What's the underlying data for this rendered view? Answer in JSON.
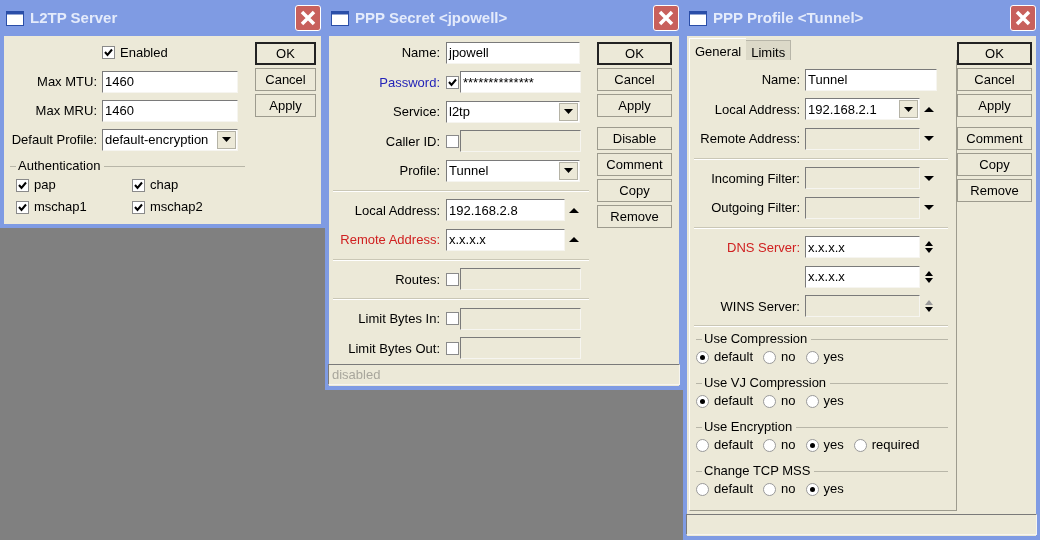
{
  "windows": [
    {
      "title": "L2TP Server",
      "rows": [
        {
          "kind": "check",
          "label": "Enabled",
          "checked": true
        },
        {
          "kind": "field",
          "label": "Max MTU:",
          "value": "1460"
        },
        {
          "kind": "field",
          "label": "Max MRU:",
          "value": "1460"
        },
        {
          "kind": "field",
          "label": "Default Profile:",
          "value": "default-encryption",
          "dropdown": true
        },
        {
          "kind": "check_group",
          "title": "Authentication",
          "items": [
            {
              "label": "pap",
              "checked": true
            },
            {
              "label": "chap",
              "checked": true
            },
            {
              "label": "mschap1",
              "checked": true
            },
            {
              "label": "mschap2",
              "checked": true
            }
          ]
        }
      ],
      "button_groups": [
        [
          "OK",
          "Cancel",
          "Apply"
        ]
      ]
    },
    {
      "title": "PPP Secret <jpowell>",
      "rows": [
        {
          "kind": "field",
          "label": "Name:",
          "value": "jpowell"
        },
        {
          "kind": "checkfield",
          "label": "Password:",
          "color": "#2323b8",
          "checked": true,
          "value": "**************"
        },
        {
          "kind": "field",
          "label": "Service:",
          "value": "l2tp",
          "dropdown": true
        },
        {
          "kind": "checkfield",
          "label": "Caller ID:",
          "checked": false,
          "disabled": true
        },
        {
          "kind": "field",
          "label": "Profile:",
          "value": "Tunnel",
          "dropdown": true
        },
        {
          "kind": "separator"
        },
        {
          "kind": "field",
          "label": "Local Address:",
          "value": "192.168.2.8",
          "arrow_up": true
        },
        {
          "kind": "field",
          "label": "Remote Address:",
          "color": "#d02020",
          "value": "x.x.x.x",
          "arrow_up": true
        },
        {
          "kind": "separator"
        },
        {
          "kind": "checkfield",
          "label": "Routes:",
          "checked": false,
          "disabled": true
        },
        {
          "kind": "separator"
        },
        {
          "kind": "checkfield",
          "label": "Limit Bytes In:",
          "checked": false,
          "disabled": true
        },
        {
          "kind": "checkfield",
          "label": "Limit Bytes Out:",
          "checked": false,
          "disabled": true
        }
      ],
      "button_groups": [
        [
          "OK",
          "Cancel",
          "Apply"
        ],
        [
          "Disable",
          "Comment",
          "Copy",
          "Remove"
        ]
      ],
      "status_bar": "disabled"
    },
    {
      "title": "PPP Profile <Tunnel>",
      "tabs": [
        {
          "label": "General",
          "selected": true
        },
        {
          "label": "Limits",
          "selected": false
        }
      ],
      "rows": [
        {
          "kind": "field",
          "label": "Name:",
          "value": "Tunnel"
        },
        {
          "kind": "field",
          "label": "Local Address:",
          "value": "192.168.2.1",
          "dropdown": true,
          "arrow_up": true
        },
        {
          "kind": "field",
          "label": "Remote Address:",
          "disabled": true,
          "arrow_down": true
        },
        {
          "kind": "separator"
        },
        {
          "kind": "field",
          "label": "Incoming Filter:",
          "disabled": true,
          "arrow_down": true
        },
        {
          "kind": "field",
          "label": "Outgoing Filter:",
          "disabled": true,
          "arrow_down": true
        },
        {
          "kind": "separator"
        },
        {
          "kind": "field",
          "label": "DNS Server:",
          "color": "#d02020",
          "value": "x.x.x.x",
          "arrow_up": true,
          "arrow_down": true
        },
        {
          "kind": "field",
          "value": "x.x.x.x",
          "arrow_up": true,
          "arrow_down": true
        },
        {
          "kind": "field",
          "label": "WINS Server:",
          "disabled": true,
          "arrow_up": true,
          "arrow_down": true
        },
        {
          "kind": "separator"
        },
        {
          "kind": "radio_group",
          "title": "Use Compression",
          "options": [
            {
              "label": "default",
              "selected": true
            },
            {
              "label": "no",
              "selected": false
            },
            {
              "label": "yes",
              "selected": false
            }
          ]
        },
        {
          "kind": "radio_group",
          "title": "Use VJ Compression",
          "options": [
            {
              "label": "default",
              "selected": true
            },
            {
              "label": "no",
              "selected": false
            },
            {
              "label": "yes",
              "selected": false
            }
          ]
        },
        {
          "kind": "radio_group",
          "title": "Use Encryption",
          "options": [
            {
              "label": "default",
              "selected": false
            },
            {
              "label": "no",
              "selected": false
            },
            {
              "label": "yes",
              "selected": true
            },
            {
              "label": "required",
              "selected": false
            }
          ]
        },
        {
          "kind": "radio_group",
          "title": "Change TCP MSS",
          "options": [
            {
              "label": "default",
              "selected": false
            },
            {
              "label": "no",
              "selected": false
            },
            {
              "label": "yes",
              "selected": true
            }
          ]
        }
      ],
      "button_groups": [
        [
          "OK",
          "Cancel",
          "Apply"
        ],
        [
          "Comment",
          "Copy",
          "Remove"
        ]
      ],
      "status_bar": true
    }
  ]
}
